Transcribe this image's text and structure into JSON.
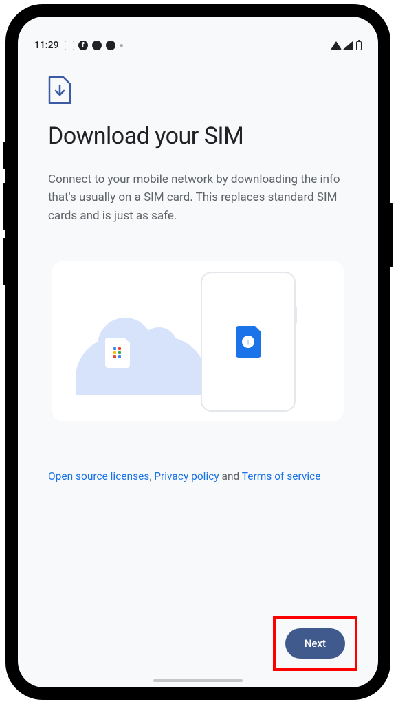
{
  "status_bar": {
    "time": "11:29"
  },
  "header": {
    "title": "Download your SIM"
  },
  "body": {
    "description": "Connect to your mobile network by downloading the info that's usually on a SIM card. This replaces standard SIM cards and is just as safe."
  },
  "links": {
    "open_source": "Open source licenses",
    "sep1": ", ",
    "privacy": "Privacy policy",
    "connector": " and ",
    "terms": "Terms of service"
  },
  "actions": {
    "next_label": "Next"
  }
}
